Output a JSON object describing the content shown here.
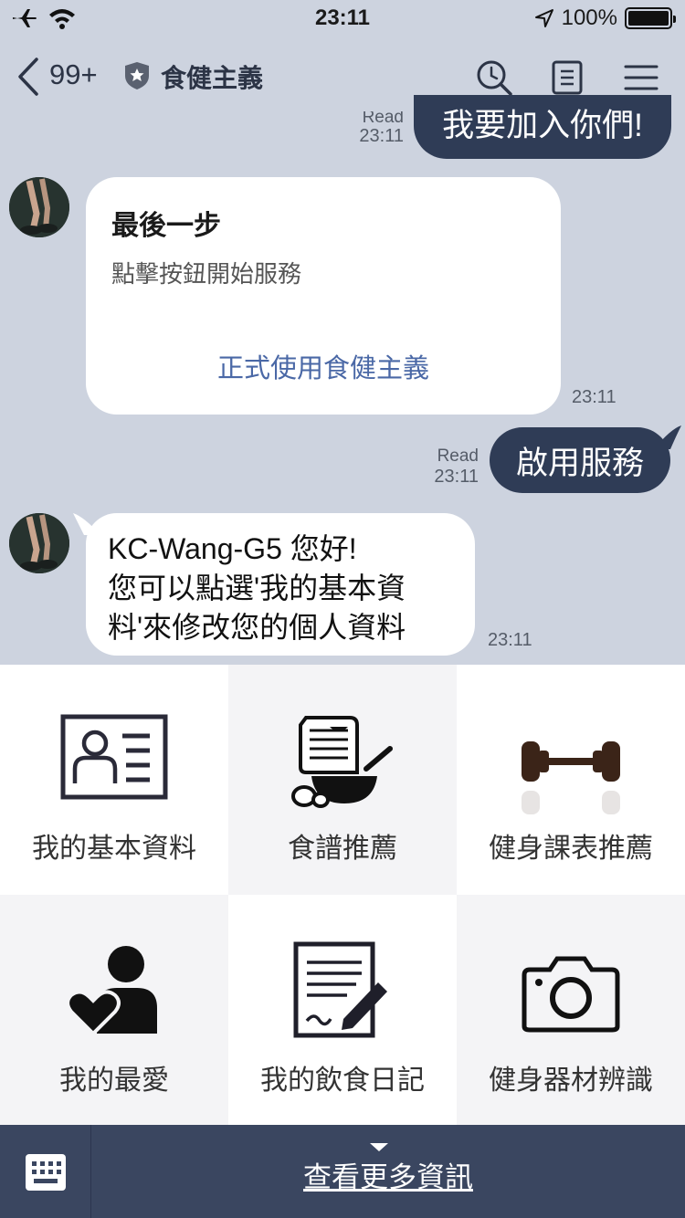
{
  "status_bar": {
    "time": "23:11",
    "battery": "100%"
  },
  "header": {
    "unread_count": "99+",
    "title": "食健主義"
  },
  "chat": {
    "prev_message": {
      "text": "我要加入你們!",
      "read": "Read",
      "time": "23:11"
    },
    "card": {
      "title": "最後一步",
      "subtitle": "點擊按鈕開始服務",
      "action": "正式使用食健主義",
      "time": "23:11"
    },
    "sent": {
      "text": "啟用服務",
      "read": "Read",
      "time": "23:11"
    },
    "reply": {
      "line1": "KC-Wang-G5 您好!",
      "line2": "您可以點選'我的基本資",
      "line3": "料'來修改您的個人資料",
      "time": "23:11"
    }
  },
  "menu": {
    "items": [
      {
        "label": "我的基本資料",
        "icon": "profile-card-icon"
      },
      {
        "label": "食譜推薦",
        "icon": "recipe-icon"
      },
      {
        "label": "健身課表推薦",
        "icon": "dumbbell-icon"
      },
      {
        "label": "我的最愛",
        "icon": "favorite-person-icon"
      },
      {
        "label": "我的飲食日記",
        "icon": "diary-icon"
      },
      {
        "label": "健身器材辨識",
        "icon": "camera-icon"
      }
    ]
  },
  "bottom_bar": {
    "more_label": "查看更多資訊"
  }
}
